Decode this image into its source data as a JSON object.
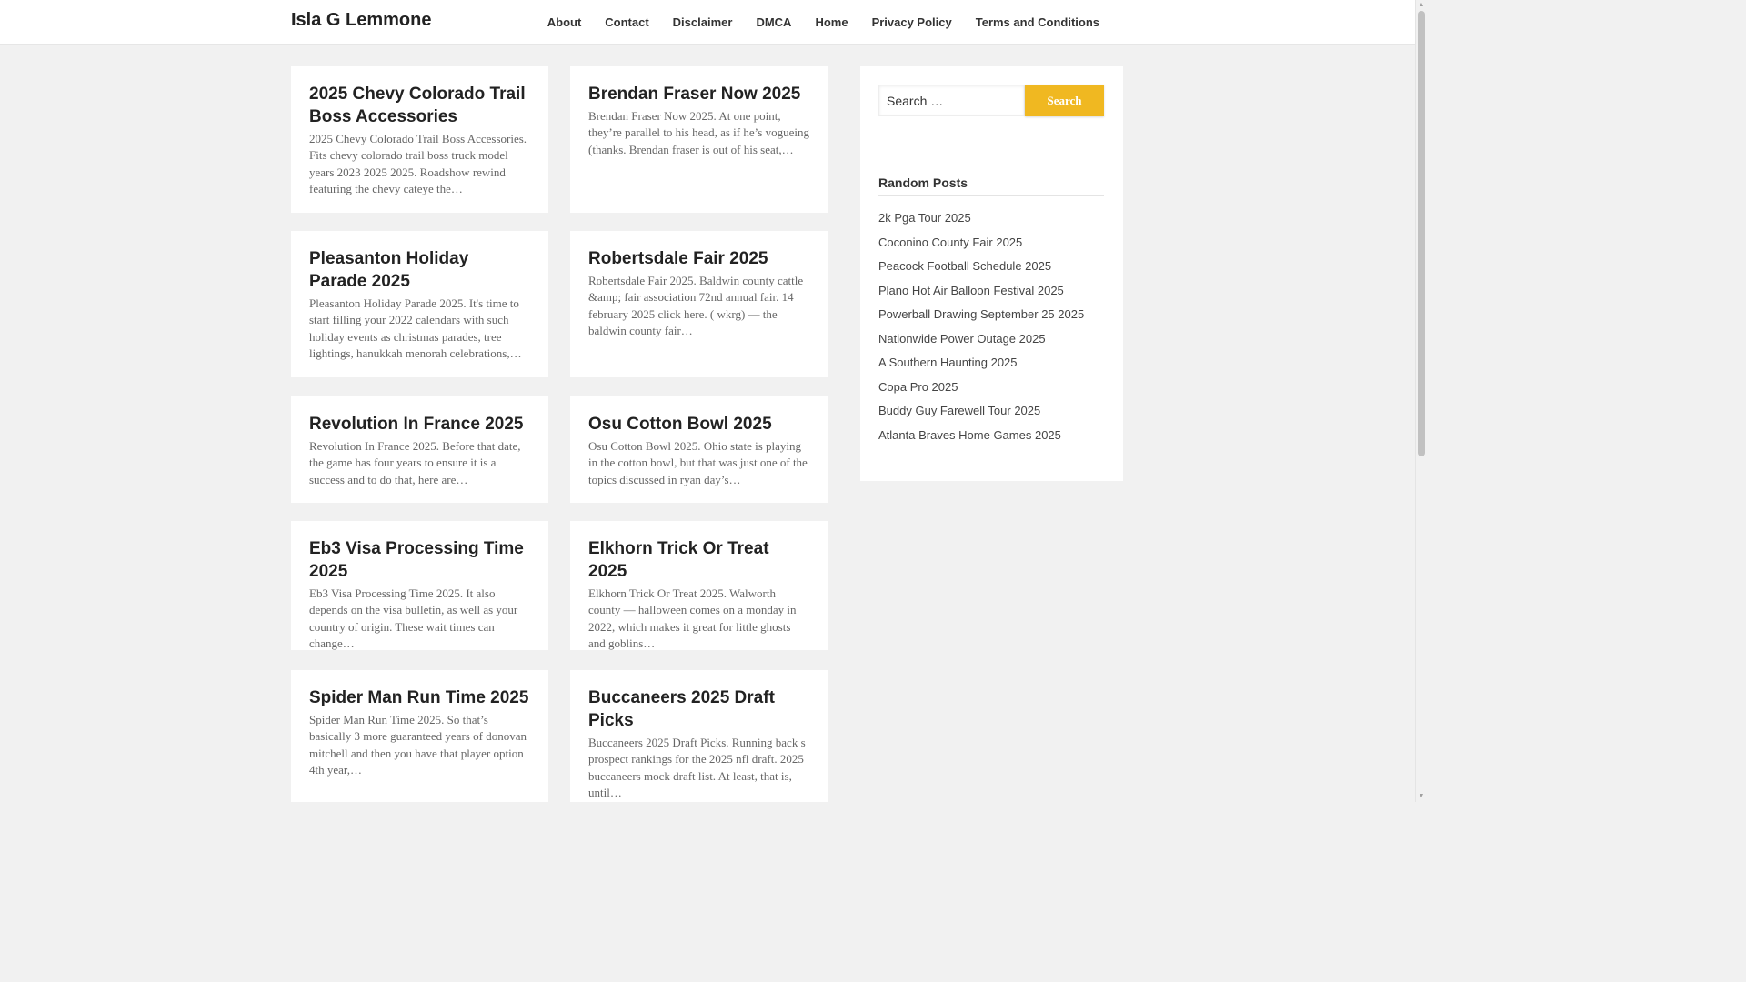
{
  "site": {
    "title": "Isla G Lemmone"
  },
  "nav": [
    "About",
    "Contact",
    "Disclaimer",
    "DMCA",
    "Home",
    "Privacy Policy",
    "Terms and Conditions"
  ],
  "posts": [
    {
      "title": "2025 Chevy Colorado Trail Boss Accessories",
      "excerpt": "2025 Chevy Colorado Trail Boss Accessories. Fits chevy colorado trail boss truck model years 2023 2025 2025. Roadshow rewind featuring the chevy cateye the…"
    },
    {
      "title": "Brendan Fraser Now 2025",
      "excerpt": "Brendan Fraser Now 2025. At one point, they’re parallel to his head, as if he’s vogueing (thanks. Brendan fraser is out of his seat,…"
    },
    {
      "title": "Pleasanton Holiday Parade 2025",
      "excerpt": "Pleasanton Holiday Parade 2025. It's time to start filling your 2022 calendars with such holiday events as christmas parades, tree lightings, hanukkah menorah celebrations,…"
    },
    {
      "title": "Robertsdale Fair 2025",
      "excerpt": "Robertsdale Fair 2025. Baldwin county cattle &amp; fair association 72nd annual fair. 14 february 2025 click here. ( wkrg) — the baldwin county fair…"
    },
    {
      "title": "Revolution In France 2025",
      "excerpt": "Revolution In France 2025. Before that date, the game has four years to ensure it is a success and to do that, here are…"
    },
    {
      "title": "Osu Cotton Bowl 2025",
      "excerpt": "Osu Cotton Bowl 2025. Ohio state is playing in the cotton bowl, but that was just one of the topics discussed in ryan day’s…"
    },
    {
      "title": "Eb3 Visa Processing Time 2025",
      "excerpt": "Eb3 Visa Processing Time 2025. It also depends on the visa bulletin, as well as your country of origin. These wait times can change…"
    },
    {
      "title": "Elkhorn Trick Or Treat 2025",
      "excerpt": "Elkhorn Trick Or Treat 2025. Walworth county — halloween comes on a monday in 2022, which makes it great for little ghosts and goblins…"
    },
    {
      "title": "Spider Man Run Time 2025",
      "excerpt": "Spider Man Run Time 2025. So that’s basically 3 more guaranteed years of donovan mitchell and then you have that player option 4th year,…"
    },
    {
      "title": "Buccaneers 2025 Draft Picks",
      "excerpt": "Buccaneers 2025 Draft Picks. Running back s prospect rankings for the 2025 nfl draft. 2025 buccaneers mock draft list. At least, that is, until…"
    }
  ],
  "sidebar": {
    "search_placeholder": "Search …",
    "search_button": "Search",
    "widget_title": "Random Posts",
    "random_posts": [
      "2k Pga Tour 2025",
      "Coconino County Fair 2025",
      "Peacock Football Schedule 2025",
      "Plano Hot Air Balloon Festival 2025",
      "Powerball Drawing September 25 2025",
      "Nationwide Power Outage 2025",
      "A Southern Haunting 2025",
      "Copa Pro 2025",
      "Buddy Guy Farewell Tour 2025",
      "Atlanta Braves Home Games 2025"
    ]
  },
  "colors": {
    "accent": "#f0b821",
    "background": "#f1f1f1"
  }
}
